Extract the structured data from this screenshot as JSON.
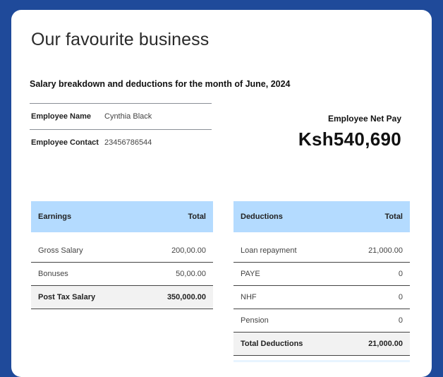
{
  "page": {
    "title": "Our favourite business",
    "subtitle": "Salary breakdown and deductions for the month of June, 2024"
  },
  "employee": {
    "name_label": "Employee Name",
    "name_value": "Cynthia Black",
    "contact_label": "Employee Contact",
    "contact_value": "23456786544"
  },
  "net_pay": {
    "label": "Employee Net Pay",
    "value": "Ksh540,690"
  },
  "earnings": {
    "header": "Earnings",
    "total_header": "Total",
    "rows": [
      {
        "label": "Gross Salary",
        "value": "200,00.00"
      },
      {
        "label": "Bonuses",
        "value": "50,00.00"
      }
    ],
    "total": {
      "label": "Post Tax Salary",
      "value": "350,000.00"
    }
  },
  "deductions": {
    "header": "Deductions",
    "total_header": "Total",
    "rows": [
      {
        "label": "Loan repayment",
        "value": "21,000.00"
      },
      {
        "label": "PAYE",
        "value": "0"
      },
      {
        "label": "NHF",
        "value": "0"
      },
      {
        "label": "Pension",
        "value": "0"
      }
    ],
    "total": {
      "label": "Total Deductions",
      "value": "21,000.00"
    }
  },
  "colors": {
    "frame": "#1f4a9a",
    "table_header": "#b4dbff"
  }
}
